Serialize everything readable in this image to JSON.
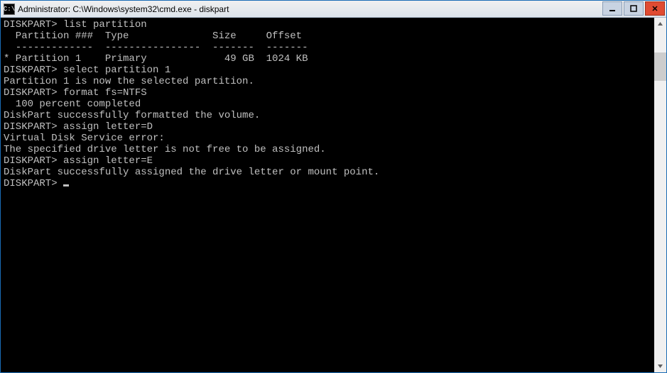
{
  "titlebar": {
    "icon_text": "C:\\",
    "title": "Administrator: C:\\Windows\\system32\\cmd.exe - diskpart"
  },
  "terminal": {
    "prompt": "DISKPART> ",
    "cmd_list_partition": "list partition",
    "blank": "",
    "header_line": "  Partition ###  Type              Size     Offset",
    "divider_line": "  -------------  ----------------  -------  -------",
    "row1": "* Partition 1    Primary             49 GB  1024 KB",
    "cmd_select_partition": "select partition 1",
    "msg_selected": "Partition 1 is now the selected partition.",
    "cmd_format": "format fs=NTFS",
    "msg_progress": "  100 percent completed",
    "msg_formatted": "DiskPart successfully formatted the volume.",
    "cmd_assign_d": "assign letter=D",
    "msg_vds_error": "Virtual Disk Service error:",
    "msg_drive_not_free": "The specified drive letter is not free to be assigned.",
    "cmd_assign_e": "assign letter=E",
    "msg_assigned": "DiskPart successfully assigned the drive letter or mount point."
  }
}
